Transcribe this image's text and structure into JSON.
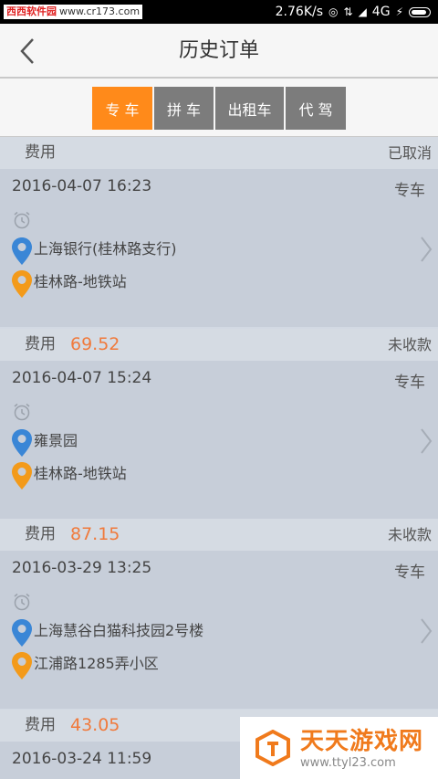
{
  "status_bar": {
    "watermark_name": "西西软件园",
    "watermark_url": "www.cr173.com",
    "network_speed": "2.76K/s",
    "network_type": "4G"
  },
  "nav": {
    "title": "历史订单"
  },
  "tabs": [
    {
      "label": "专 车",
      "active": true
    },
    {
      "label": "拼 车",
      "active": false
    },
    {
      "label": "出租车",
      "active": false
    },
    {
      "label": "代 驾",
      "active": false
    }
  ],
  "orders": [
    {
      "fee_label": "费用",
      "amount": "",
      "status": "已取消",
      "datetime": "2016-04-07 16:23",
      "type": "专车",
      "from": "上海银行(桂林路支行)",
      "to": "桂林路-地铁站"
    },
    {
      "fee_label": "费用",
      "amount": "69.52",
      "status": "未收款",
      "datetime": "2016-04-07 15:24",
      "type": "专车",
      "from": "雍景园",
      "to": "桂林路-地铁站"
    },
    {
      "fee_label": "费用",
      "amount": "87.15",
      "status": "未收款",
      "datetime": "2016-03-29 13:25",
      "type": "专车",
      "from": "上海慧谷白猫科技园2号楼",
      "to": "江浦路1285弄小区"
    },
    {
      "fee_label": "费用",
      "amount": "43.05",
      "status": "",
      "datetime": "2016-03-24 11:59",
      "type": "",
      "from": "",
      "to": ""
    }
  ],
  "watermark": {
    "name": "天天游戏网",
    "url": "www.ttyl23.com"
  },
  "colors": {
    "accent": "#ff8a1a",
    "amount": "#f07a3c",
    "pin_start": "#3a86d6",
    "pin_end": "#f39a1a"
  }
}
